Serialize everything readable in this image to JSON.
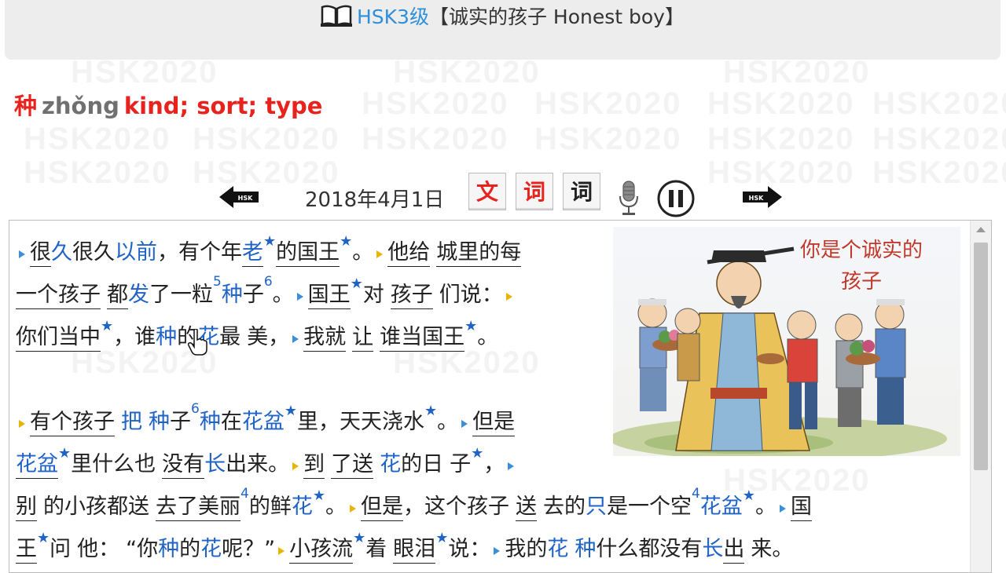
{
  "header": {
    "level": "HSK3级",
    "title": "【诚实的孩子 Honest boy】"
  },
  "word": {
    "hanzi": "种",
    "pinyin": "zhǒng",
    "meaning": "kind; sort; type"
  },
  "watermark": "HSK2020",
  "toolbar": {
    "date": "2018年4月1日",
    "btn_text": "文",
    "btn_words_red": "词",
    "btn_words_black": "词"
  },
  "illustration": {
    "caption_line1": "你是个诚实的",
    "caption_line2": "孩子"
  },
  "star": "★",
  "para": {
    "l1": {
      "a": "很",
      "b": "久",
      "c": "很久",
      "d": "以前",
      "e": "，有个年",
      "f": "老",
      "g": "的国王",
      "h": "。",
      "i": "他给",
      "j": "城里的每"
    },
    "l2": {
      "a": "一个孩子",
      "b": "都",
      "c": "发",
      "d": "了一粒",
      "s1": "5",
      "e": "种",
      "f": "子",
      "s2": "6",
      "g": "。",
      "h": "国王",
      "i": "对",
      "j": "孩子",
      "k": "们说："
    },
    "l3": {
      "a": "你们当中",
      "b": "，谁",
      "c": "种",
      "d": "的",
      "e": "花",
      "f": "最",
      "g": "美，",
      "h": "我就",
      "i": "让",
      "j": "谁当国王",
      "k": "。"
    },
    "l4": {
      "a": "有个孩子",
      "b": "把",
      "c": "种",
      "d": "子",
      "s1": "6",
      "e": "种",
      "f": "在",
      "g": "花盆",
      "h": "里，天天浇水",
      "i": "。",
      "j": "但是"
    },
    "l5": {
      "a": "花盆",
      "b": "里什么也",
      "c": "没有",
      "d": "长",
      "e": "出来。",
      "f": "到",
      "g": "了送",
      "h": "花",
      "i": "的日",
      "j": "子",
      "k": "，"
    },
    "l6": {
      "a": "别",
      "b": "的小孩都送",
      "c": "去了美丽",
      "s1": "4",
      "d": "的鲜",
      "e": "花",
      "f": "。",
      "g": "但是",
      "h": "，这个孩子",
      "i": "送",
      "j": "去的",
      "k": "只",
      "l": "是一个空",
      "s2": "4",
      "m": "花盆",
      "n": "。",
      "o": "国"
    },
    "l7": {
      "a": "王",
      "b": "问",
      "c": "他：",
      "d": "“你",
      "e": "种",
      "f": "的",
      "g": "花",
      "h": "呢？”",
      "i": "小孩流",
      "j": "着",
      "k": "眼泪",
      "l": "说：",
      "m": "我的",
      "n": "花",
      "o": "种",
      "p": "什么都没有",
      "q": "长",
      "r": "出",
      "s": "来。"
    }
  }
}
